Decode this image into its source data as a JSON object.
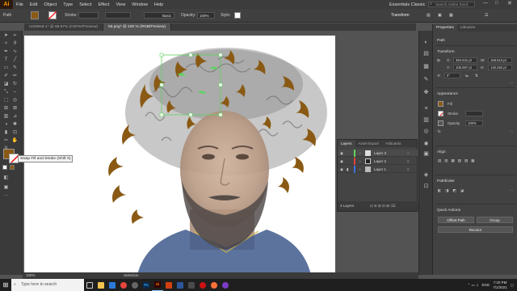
{
  "app": {
    "logo": "Ai"
  },
  "menu": [
    "File",
    "Edit",
    "Object",
    "Type",
    "Select",
    "Effect",
    "View",
    "Window",
    "Help"
  ],
  "workspace": {
    "label": "Essentials Classic",
    "search_placeholder": "Search Adobe Stock"
  },
  "control": {
    "object_type": "Path",
    "stroke_label": "Stroke:",
    "brush_label": "Basic",
    "opacity_label": "Opacity:",
    "opacity_value": "100%",
    "style_label": "Style:",
    "transform_label": "Transform",
    "fill_color": "#8a5a14"
  },
  "tabs": [
    {
      "label": "UntiWed-1* @ 66.67% (CMYK/Preview)"
    },
    {
      "label": "55.png* @ 100 % (RGB/Preview)"
    }
  ],
  "tooltip": "Swap Fill and Stroke (Shift X)",
  "layers": {
    "tabs": [
      "Layers",
      "Asset Export",
      "Artboards"
    ],
    "rows": [
      {
        "name": "Layer 3"
      },
      {
        "name": "Layer 2"
      },
      {
        "name": "Layer 1"
      }
    ],
    "footer": "3 Layers"
  },
  "properties": {
    "tabs": [
      "Properties",
      "Libraries"
    ],
    "object_type": "Path",
    "transform": {
      "title": "Transform",
      "x": "384.541 pt",
      "y": "105.587 pt",
      "w": "158.613 pt",
      "h": "140.262 pt",
      "angle": "0°"
    },
    "appearance": {
      "title": "Appearance",
      "fill": "Fill",
      "stroke": "Stroke",
      "stroke_value": "",
      "opacity": "Opacity",
      "opacity_value": "100%"
    },
    "align": {
      "title": "Align"
    },
    "pathfinder": {
      "title": "Pathfinder"
    },
    "quick_actions": {
      "title": "Quick Actions",
      "offset_path": "Offset Path",
      "group": "Group",
      "recolor": "Recolor"
    }
  },
  "status": {
    "zoom": "100%",
    "tool": "Selection"
  },
  "taskbar": {
    "search": "Type here to search",
    "lang": "ENG",
    "time": "7:20 PM",
    "date": "7/1/2021"
  },
  "colors": {
    "hair": "#8a5a14",
    "selection": "#5fd35f",
    "accent": "#ff9a00"
  }
}
